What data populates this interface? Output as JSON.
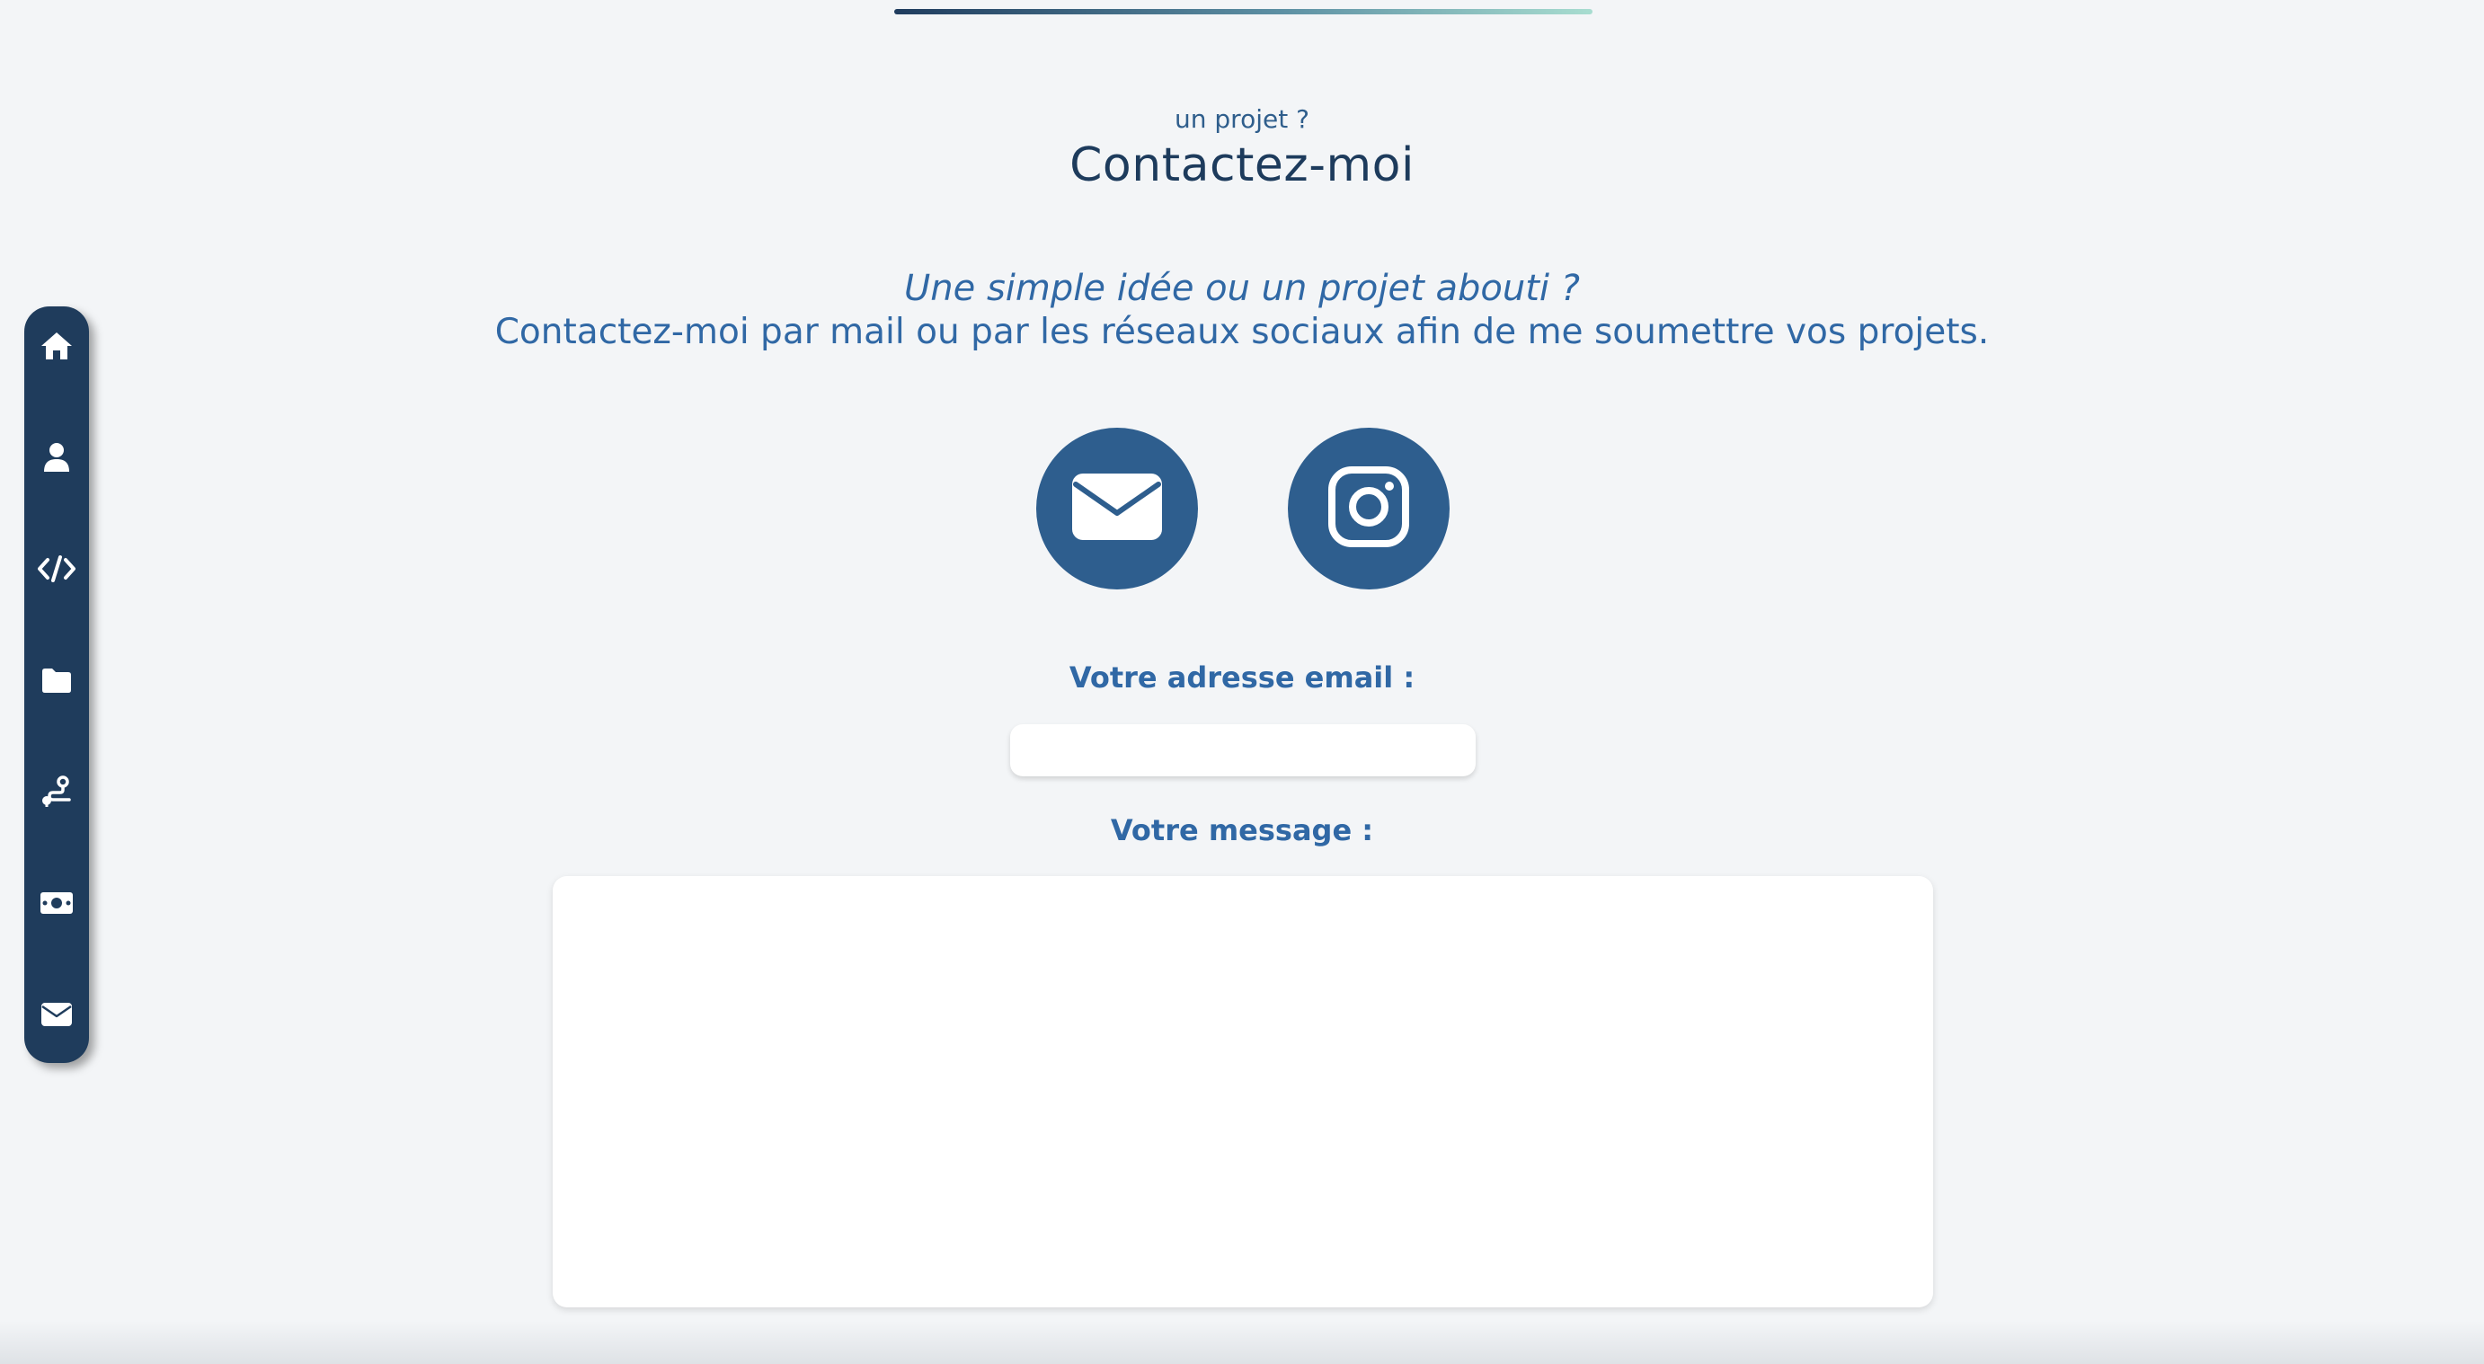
{
  "header": {
    "kicker": "un projet ?",
    "title": "Contactez-moi"
  },
  "intro": {
    "line1": "Une simple idée ou un projet abouti ?",
    "line2": "Contactez-moi par mail ou par les réseaux sociaux afin de me soumettre vos projets."
  },
  "social": [
    {
      "icon": "envelope-icon"
    },
    {
      "icon": "instagram-icon"
    }
  ],
  "form": {
    "email_label": "Votre adresse email :",
    "email_value": "",
    "message_label": "Votre message :",
    "message_value": ""
  },
  "sidebar": {
    "items": [
      {
        "icon": "home-icon"
      },
      {
        "icon": "user-icon"
      },
      {
        "icon": "code-icon"
      },
      {
        "icon": "folder-icon"
      },
      {
        "icon": "route-icon"
      },
      {
        "icon": "money-bill-icon"
      },
      {
        "icon": "envelope-icon"
      }
    ]
  },
  "colors": {
    "accent": "#2e5e8e",
    "sidebar": "#1f3c5c",
    "text_primary": "#1d3b5c",
    "text_secondary": "#3068a5",
    "background": "#f3f5f7"
  }
}
